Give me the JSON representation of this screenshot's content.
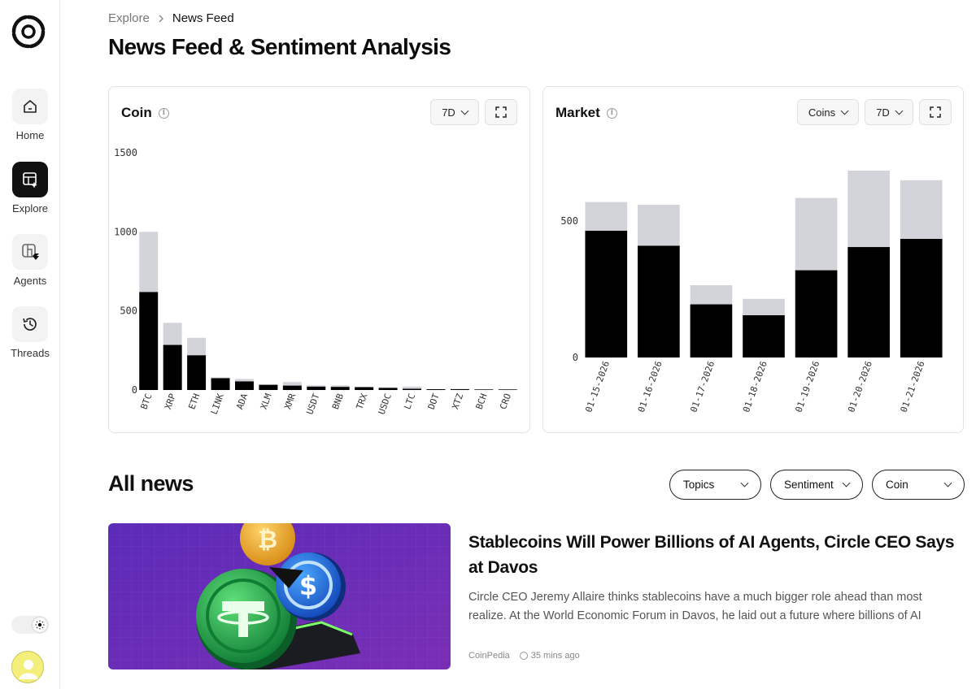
{
  "sidebar": {
    "items": [
      {
        "label": "Home",
        "icon": "home-icon"
      },
      {
        "label": "Explore",
        "icon": "explore-icon",
        "active": true
      },
      {
        "label": "Agents",
        "icon": "agents-icon"
      },
      {
        "label": "Threads",
        "icon": "threads-icon"
      }
    ]
  },
  "breadcrumb": {
    "parent": "Explore",
    "current": "News Feed"
  },
  "page_title": "News Feed & Sentiment Analysis",
  "coin_card": {
    "title": "Coin",
    "range": "7D"
  },
  "market_card": {
    "title": "Market",
    "filter": "Coins",
    "range": "7D"
  },
  "chart_data": [
    {
      "type": "bar",
      "title": "Coin",
      "stacked": true,
      "categories": [
        "BTC",
        "XRP",
        "ETH",
        "LINK",
        "ADA",
        "XLM",
        "XMR",
        "USDT",
        "BNB",
        "TRX",
        "USDC",
        "LTC",
        "DOT",
        "XTZ",
        "BCH",
        "CRO"
      ],
      "series": [
        {
          "values": [
            620,
            285,
            220,
            75,
            55,
            33,
            28,
            22,
            20,
            18,
            14,
            8,
            5,
            5,
            4,
            4
          ]
        },
        {
          "values": [
            380,
            140,
            110,
            5,
            15,
            2,
            22,
            8,
            10,
            2,
            3,
            14,
            0,
            3,
            2,
            1
          ]
        }
      ],
      "ylim": [
        0,
        1500
      ],
      "yticks": [
        0,
        500,
        1000,
        1500
      ],
      "colors": [
        "#000000",
        "#d3d4da"
      ]
    },
    {
      "type": "bar",
      "title": "Market",
      "stacked": true,
      "categories": [
        "01-15-2026",
        "01-16-2026",
        "01-17-2026",
        "01-18-2026",
        "01-19-2026",
        "01-20-2026",
        "01-21-2026"
      ],
      "series": [
        {
          "values": [
            465,
            410,
            195,
            155,
            320,
            405,
            435
          ]
        },
        {
          "values": [
            105,
            150,
            70,
            60,
            265,
            280,
            215
          ]
        }
      ],
      "ylim": [
        0,
        700
      ],
      "yticks": [
        0,
        500
      ],
      "colors": [
        "#000000",
        "#d3d4da"
      ]
    }
  ],
  "all_news": {
    "title": "All news",
    "filters": [
      "Topics",
      "Sentiment",
      "Coin"
    ]
  },
  "news": [
    {
      "headline": "Stablecoins Will Power Billions of AI Agents, Circle CEO Says at Davos",
      "summary": "Circle CEO Jeremy Allaire thinks stablecoins have a much bigger role ahead than most realize. At the World Economic Forum in Davos, he laid out a future where billions of AI agents run…",
      "source": "CoinPedia",
      "time": "35 mins ago"
    }
  ]
}
